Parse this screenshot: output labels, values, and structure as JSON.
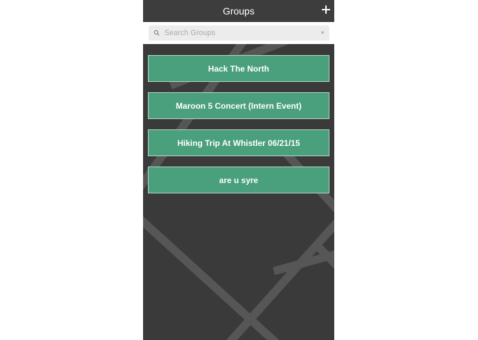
{
  "navbar": {
    "title": "Groups",
    "add_icon": "plus-icon"
  },
  "search": {
    "placeholder": "Search Groups",
    "value": "",
    "search_icon": "search-icon",
    "clear_icon": "clear-icon",
    "clear_glyph": "×"
  },
  "groups": [
    {
      "name": "Hack The North"
    },
    {
      "name": "Maroon 5 Concert (Intern Event)"
    },
    {
      "name": "Hiking Trip At Whistler 06/21/15"
    },
    {
      "name": "are u syre"
    }
  ],
  "colors": {
    "card_green": "#4a9f7c",
    "background_dark": "#3a3a3b",
    "map_road": "#575758"
  }
}
